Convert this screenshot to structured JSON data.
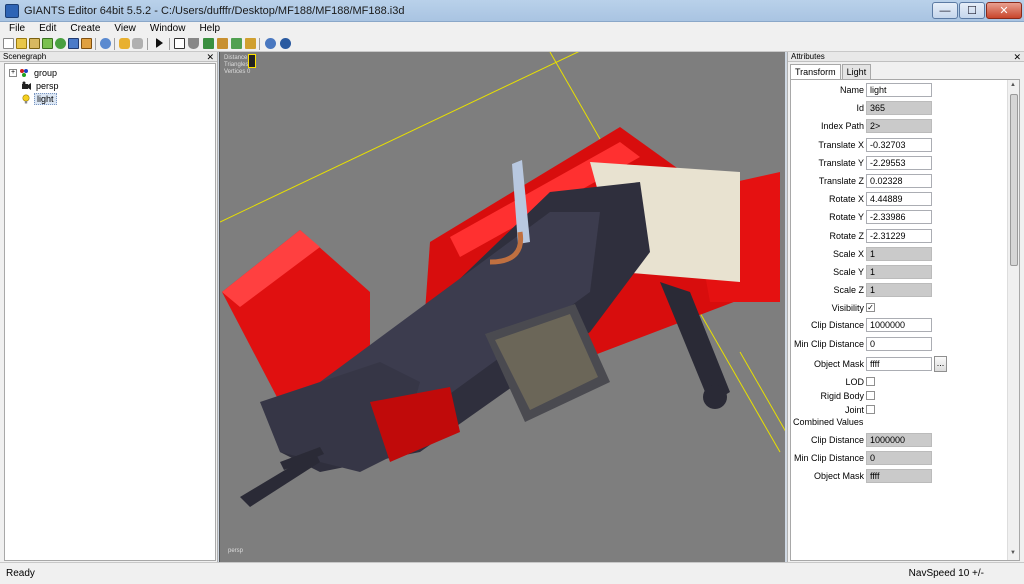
{
  "window": {
    "title": "GIANTS Editor 64bit 5.5.2 - C:/Users/dufffr/Desktop/MF188/MF188/MF188.i3d",
    "min_glyph": "—",
    "max_glyph": "☐",
    "close_glyph": "✕"
  },
  "menu": [
    "File",
    "Edit",
    "Create",
    "View",
    "Window",
    "Help"
  ],
  "toolbar_icons": [
    "new-file-icon",
    "open-icon",
    "save-icon",
    "save-as-icon",
    "reload-icon",
    "export-icon",
    "import-icon",
    "print-icon",
    "undo-icon",
    "redo-icon",
    "play-icon",
    "select-icon",
    "magnet-icon",
    "terrain-icon",
    "paint-icon",
    "foliage-icon",
    "brush-icon",
    "settings-icon",
    "gear-icon"
  ],
  "scenegraph": {
    "title": "Scenegraph",
    "close_glyph": "✕",
    "expander": "+",
    "nodes": [
      {
        "label": "group",
        "icon": "group-node-icon"
      },
      {
        "label": "persp",
        "icon": "camera-node-icon"
      },
      {
        "label": "light",
        "icon": "light-bulb-icon"
      }
    ]
  },
  "viewport": {
    "stats_lines": [
      "Distance",
      "Triangles",
      "Vertices 0"
    ],
    "camera": "persp"
  },
  "attributes": {
    "title": "Attributes",
    "close_glyph": "✕",
    "tabs": [
      "Transform",
      "Light"
    ],
    "active_tab": "Transform",
    "rows": [
      {
        "label": "Name",
        "value": "light",
        "readonly": false
      },
      {
        "label": "Id",
        "value": "365",
        "readonly": true
      },
      {
        "label": "Index Path",
        "value": "2>",
        "readonly": true
      },
      {
        "label": "Translate X",
        "value": "-0.32703",
        "readonly": false
      },
      {
        "label": "Translate Y",
        "value": "-2.29553",
        "readonly": false
      },
      {
        "label": "Translate Z",
        "value": "0.02328",
        "readonly": false
      },
      {
        "label": "Rotate X",
        "value": "4.44889",
        "readonly": false
      },
      {
        "label": "Rotate Y",
        "value": "-2.33986",
        "readonly": false
      },
      {
        "label": "Rotate Z",
        "value": "-2.31229",
        "readonly": false
      },
      {
        "label": "Scale X",
        "value": "1",
        "readonly": true
      },
      {
        "label": "Scale Y",
        "value": "1",
        "readonly": true
      },
      {
        "label": "Scale Z",
        "value": "1",
        "readonly": true
      }
    ],
    "visibility": {
      "label": "Visibility",
      "checked": true,
      "glyph": "✓"
    },
    "clip_distance": {
      "label": "Clip Distance",
      "value": "1000000"
    },
    "min_clip_distance": {
      "label": "Min Clip Distance",
      "value": "0"
    },
    "object_mask": {
      "label": "Object Mask",
      "value": "ffff",
      "browse": "..."
    },
    "flags": [
      {
        "label": "LOD",
        "checked": false
      },
      {
        "label": "Rigid Body",
        "checked": false
      },
      {
        "label": "Joint",
        "checked": false
      }
    ],
    "combined_title": "Combined Values",
    "combined": [
      {
        "label": "Clip Distance",
        "value": "1000000"
      },
      {
        "label": "Min Clip Distance",
        "value": "0"
      },
      {
        "label": "Object Mask",
        "value": "ffff"
      }
    ],
    "scroll_up": "▲",
    "scroll_down": "▼"
  },
  "status": {
    "text": "Ready",
    "navspeed": "NavSpeed 10 +/-"
  },
  "colors": {
    "viewport_bg": "#7e7e7e",
    "model_red": "#e01010",
    "model_dark": "#2f2f3d",
    "guide_line": "#e8e000"
  }
}
